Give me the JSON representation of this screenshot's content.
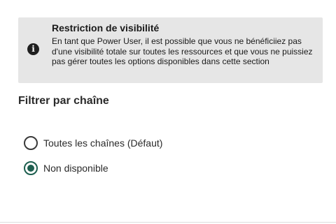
{
  "notice": {
    "icon": "info-icon",
    "icon_glyph": "i",
    "title": "Restriction de visibilité",
    "body": "En tant que Power User, il est possible que vous ne bénéficiiez pas d'une visibilité totale sur toutes les ressources et que vous ne puissiez pas gérer toutes les options disponibles dans cette section"
  },
  "filter": {
    "title": "Filtrer par chaîne",
    "options": [
      {
        "label": "Toutes les chaînes (Défaut)",
        "selected": false
      },
      {
        "label": "Non disponible",
        "selected": true
      }
    ]
  },
  "colors": {
    "accent": "#1e5f4f",
    "notice_bg": "#e6e6e6"
  }
}
